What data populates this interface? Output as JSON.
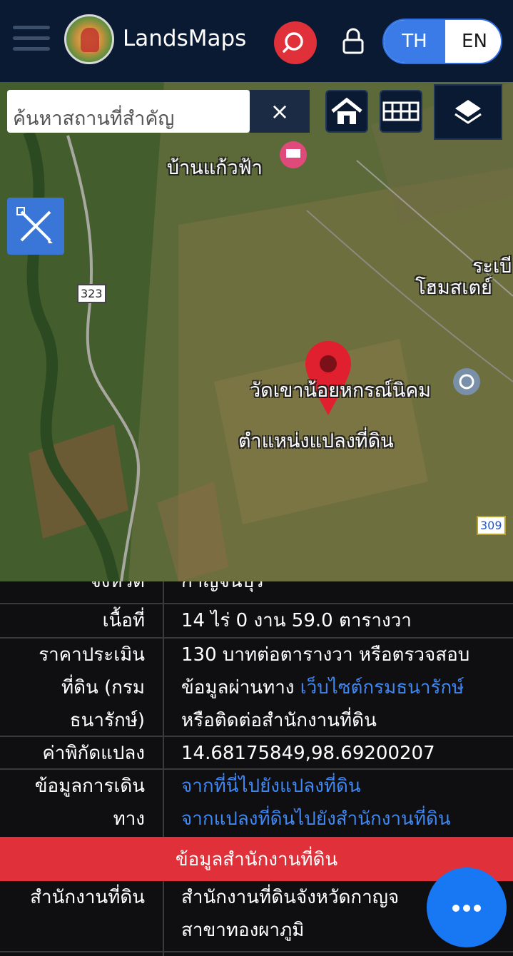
{
  "header": {
    "brand": "LandsMaps",
    "lang_th": "TH",
    "lang_en": "EN"
  },
  "map": {
    "search_placeholder": "ค้นหาสถานที่สำคัญ",
    "clear_label": "×",
    "labels": {
      "place1": "บ้านแก้วฟ้า",
      "place2a": "ระเบี",
      "place2b": "โฮมสเตย์",
      "temple": "วัดเขาน้อยหกรณ์นิคม",
      "parcel_position": "ตำแหน่งแปลงที่ดิน",
      "road_323": "323",
      "road_309": "309"
    }
  },
  "info": {
    "rows": [
      {
        "label": "จังหวัด",
        "value": "กาญจนบุรี"
      },
      {
        "label": "เนื้อที่",
        "value": "14 ไร่ 0 งาน 59.0 ตารางวา"
      },
      {
        "label_lines": [
          "ราคาประเมิน",
          "ที่ดิน (กรม",
          "ธนารักษ์)"
        ],
        "value_line1": "130 บาทต่อตารางวา หรือตรวจสอบ",
        "value_line2_prefix": "ข้อมูลผ่านทาง ",
        "value_line2_link": "เว็บไซต์กรมธนารักษ์",
        "value_line3": "หรือติดต่อสำนักงานที่ดิน"
      },
      {
        "label": "ค่าพิกัดแปลง",
        "value": "14.68175849,98.69200207"
      },
      {
        "label_lines": [
          "ข้อมูลการเดิน",
          "ทาง"
        ],
        "link1": "จากที่นี่ไปยังแปลงที่ดิน",
        "link2": "จากแปลงที่ดินไปยังสำนักงานที่ดิน"
      }
    ],
    "section_title": "ข้อมูลสำนักงานที่ดิน",
    "office": {
      "label": "สำนักงานที่ดิน",
      "value_line1": "สำนักงานที่ดินจังหวัดกาญจ",
      "value_line2": "สาขาทองผาภูมิ"
    }
  },
  "colors": {
    "header_bg": "#0b1a33",
    "accent_red": "#e0303a",
    "accent_blue": "#3b7be8",
    "link_blue": "#3f87f2"
  }
}
